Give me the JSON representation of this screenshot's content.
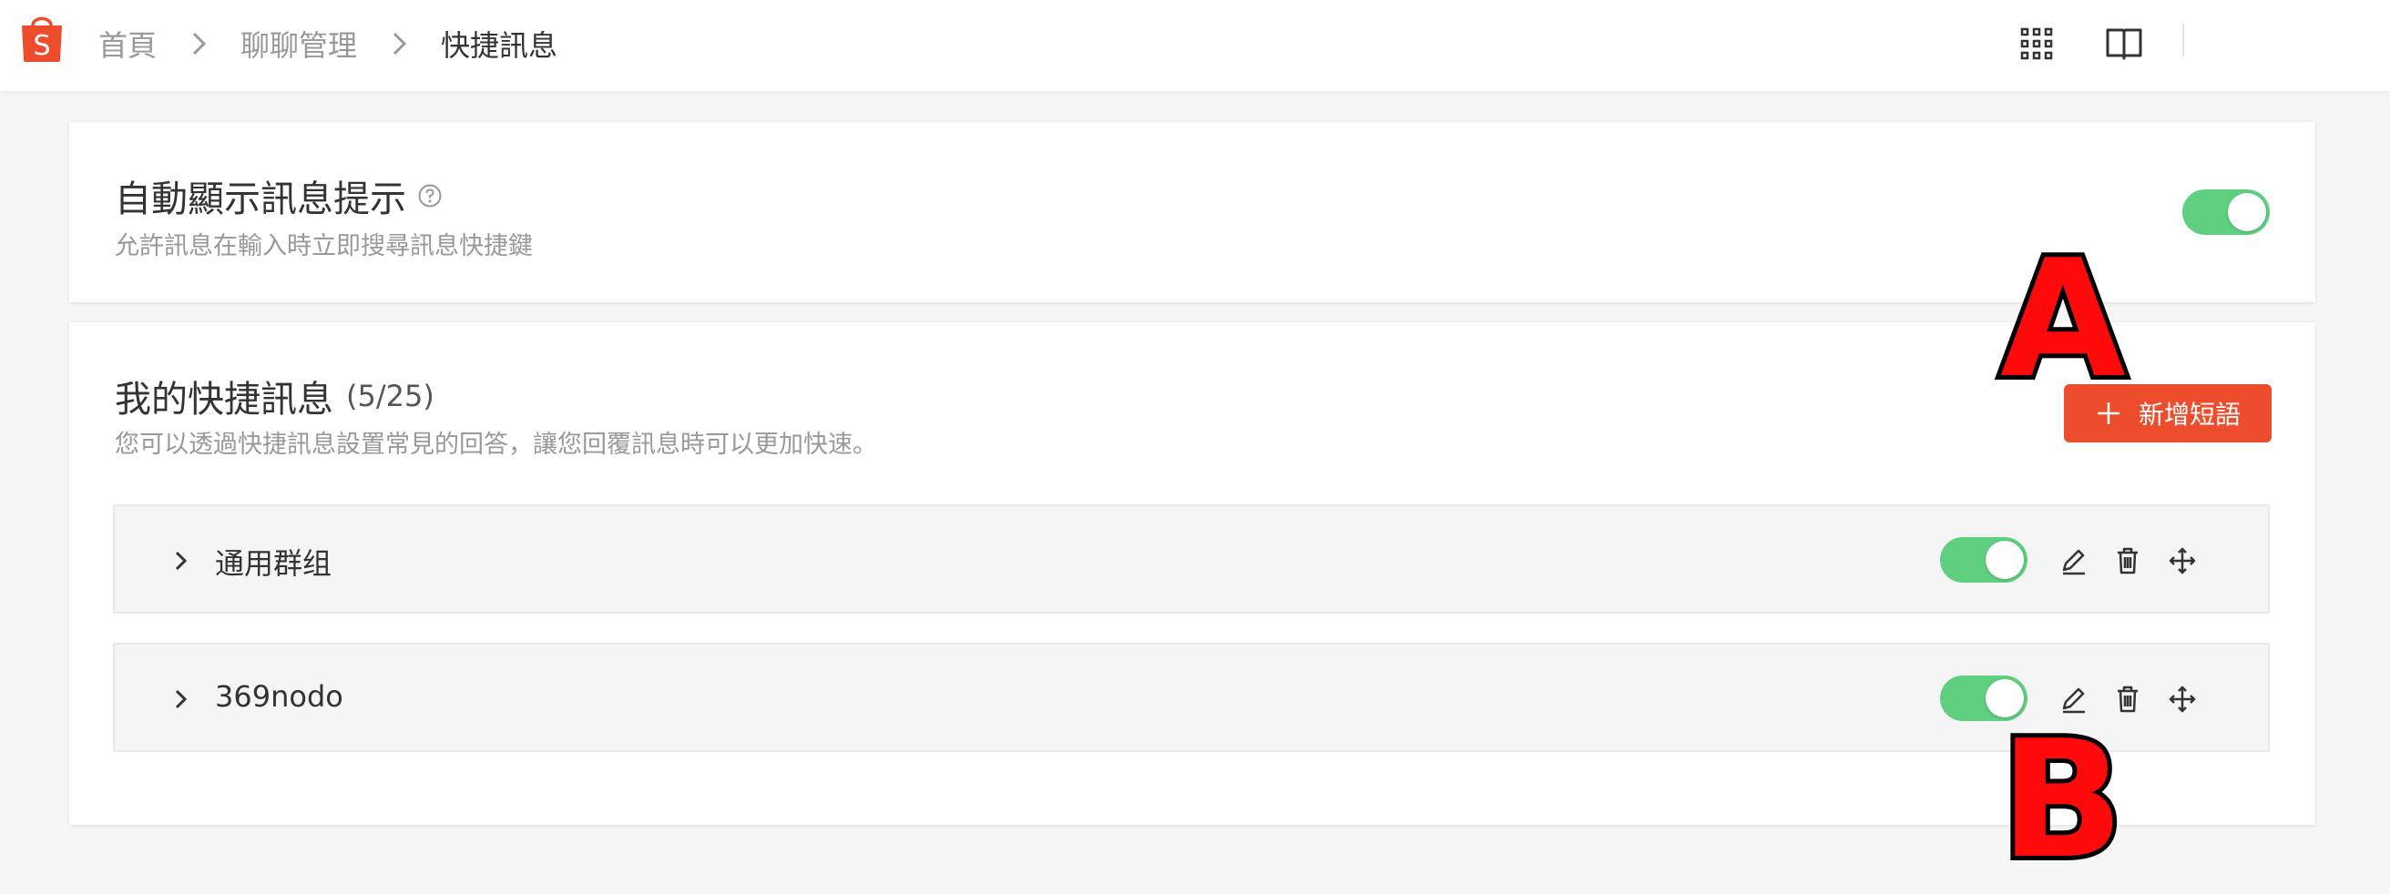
{
  "topbar": {
    "breadcrumb": [
      {
        "label": "首頁"
      },
      {
        "label": "聊聊管理"
      },
      {
        "label": "快捷訊息"
      }
    ],
    "icons": [
      "apps-grid-icon",
      "book-icon"
    ]
  },
  "auto_hint": {
    "title": "自動顯示訊息提示",
    "description": "允許訊息在輸入時立即搜尋訊息快捷鍵",
    "enabled": true
  },
  "quick_replies": {
    "title": "我的快捷訊息",
    "count": "(5/25)",
    "description": "您可以透過快捷訊息設置常見的回答，讓您回覆訊息時可以更加快速。",
    "add_button": "新增短語",
    "groups": [
      {
        "name": "通用群组",
        "enabled": true
      },
      {
        "name": "369nodo",
        "enabled": true
      }
    ]
  },
  "annotations": {
    "a": "A",
    "b": "B"
  },
  "colors": {
    "brand": "#ee4d2d",
    "toggle_on": "#5fcf80",
    "annotation": "#ff0a0a"
  }
}
